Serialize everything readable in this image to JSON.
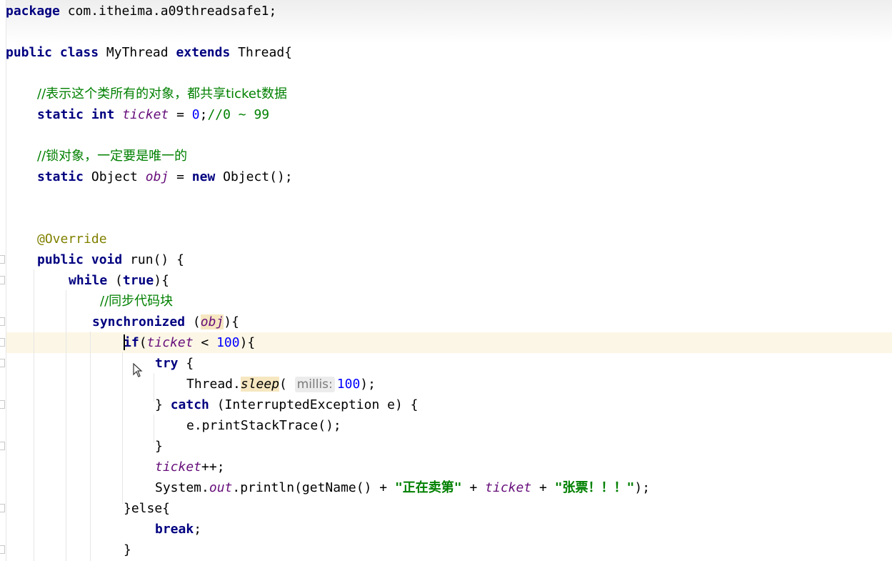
{
  "editor": {
    "lines": {
      "package_kw": "package",
      "package_name": " com.itheima.a09threadsafe1;",
      "public_kw": "public",
      "class_kw": "class",
      "class_name": " MyThread ",
      "extends_kw": "extends",
      "super_class": " Thread{",
      "comment_ticket": "//表示这个类所有的对象，都共享ticket数据",
      "static_kw": "static",
      "int_kw": " int ",
      "ticket_field": "ticket",
      "ticket_assign": " = ",
      "zero": "0",
      "ticket_semicolon": ";",
      "ticket_comment": "//0 ~ 99",
      "comment_lock": "//锁对象，一定要是唯一的",
      "object_type": " Object ",
      "obj_field": "obj",
      "obj_assign": " = ",
      "new_kw": "new",
      "object_ctor": " Object();",
      "override_anno": "@Override",
      "void_kw": " void ",
      "run_sig": "run() {",
      "while_kw": "while",
      "while_open": " (",
      "true_kw": "true",
      "while_close": "){",
      "comment_sync": "//同步代码块",
      "synchronized_kw": "synchronized",
      "sync_open": " (",
      "sync_obj": "obj",
      "sync_close": "){",
      "if_kw": "if",
      "if_open": "(",
      "if_field": "ticket",
      "if_lt": " < ",
      "if_num": "100",
      "if_close": "){",
      "try_kw": "try",
      "try_brace": " {",
      "thread_call": "Thread.",
      "sleep_method": "sleep",
      "sleep_open": "( ",
      "millis_hint": "millis:",
      "sleep_num": "100",
      "sleep_close": ");",
      "catch_brace_open": "} ",
      "catch_kw": "catch",
      "catch_rest": " (InterruptedException e) {",
      "print_stack": "e.printStackTrace();",
      "close_brace": "}",
      "ticket_inc_field": "ticket",
      "ticket_inc": "++;",
      "system_call": "System.",
      "out_field": "out",
      "println_part": ".println(getName() + ",
      "str_selling": "\"正在卖第\"",
      "plus_1": " + ",
      "println_field": "ticket",
      "plus_2": " + ",
      "str_ticket": "\"张票！！！\"",
      "println_end": ");",
      "else_line": "}else{",
      "break_kw": "break",
      "break_semi": ";",
      "inner_close": "}"
    }
  }
}
